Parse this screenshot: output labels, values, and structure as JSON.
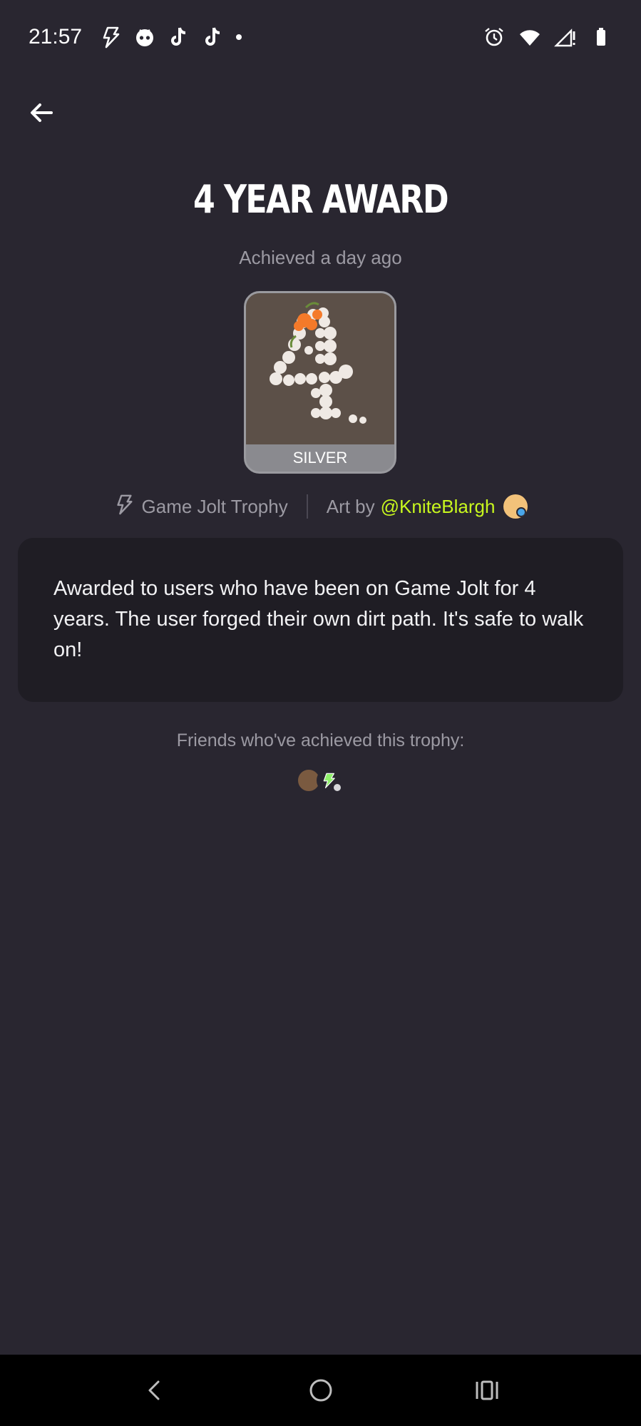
{
  "status_bar": {
    "time": "21:57",
    "left_icons": [
      "game-jolt-icon",
      "discord-icon",
      "tiktok-icon",
      "tiktok-icon",
      "notification-dot-icon"
    ],
    "right_icons": [
      "alarm-icon",
      "wifi-icon",
      "signal-icon",
      "battery-icon"
    ]
  },
  "header": {
    "back_icon": "back-arrow-icon"
  },
  "trophy": {
    "title": "4 YEAR AWARD",
    "achieved": "Achieved a day ago",
    "tier": "SILVER",
    "tier_color": "#8a8a8f",
    "source_label": "Game Jolt Trophy",
    "art_by_label": "Art by",
    "artist_handle": "@KniteBlargh",
    "description": "Awarded to users who have been on Game Jolt for 4 years. The user forged their own dirt path. It's safe to walk on!"
  },
  "friends": {
    "label": "Friends who've achieved this trophy:",
    "avatars": [
      "friend-avatar",
      "game-jolt-avatar"
    ]
  },
  "nav_bar": {
    "buttons": [
      "nav-back-icon",
      "nav-home-icon",
      "nav-recents-icon"
    ]
  },
  "colors": {
    "background": "#292630",
    "card": "#1f1d24",
    "accent": "#c8f71e",
    "muted_text": "#9c9aa3"
  }
}
